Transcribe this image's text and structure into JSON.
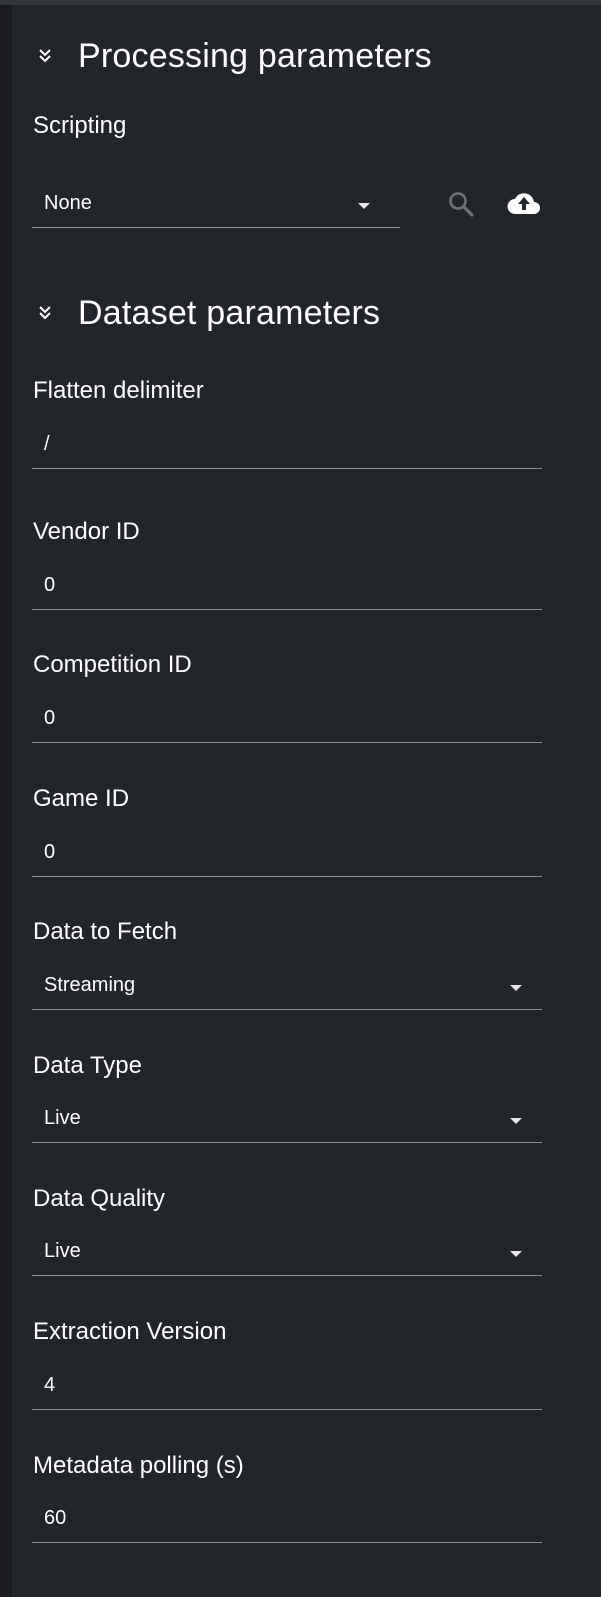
{
  "processing": {
    "title": "Processing parameters",
    "scripting": {
      "label": "Scripting",
      "value": "None"
    },
    "icons": [
      "search-icon",
      "cloud-upload-icon"
    ]
  },
  "dataset": {
    "title": "Dataset parameters",
    "fields": {
      "flatten_delimiter": {
        "label": "Flatten delimiter",
        "value": "/"
      },
      "vendor_id": {
        "label": "Vendor ID",
        "value": "0"
      },
      "competition_id": {
        "label": "Competition ID",
        "value": "0"
      },
      "game_id": {
        "label": "Game ID",
        "value": "0"
      },
      "data_to_fetch": {
        "label": "Data to Fetch",
        "value": "Streaming"
      },
      "data_type": {
        "label": "Data Type",
        "value": "Live"
      },
      "data_quality": {
        "label": "Data Quality",
        "value": "Live"
      },
      "extraction_version": {
        "label": "Extraction Version",
        "value": "4"
      },
      "metadata_polling": {
        "label": "Metadata polling (s)",
        "value": "60"
      }
    }
  },
  "colors": {
    "background": "#22252a",
    "underline": "#8a8d92",
    "text": "#ffffff",
    "icon_muted": "#6f7378"
  }
}
